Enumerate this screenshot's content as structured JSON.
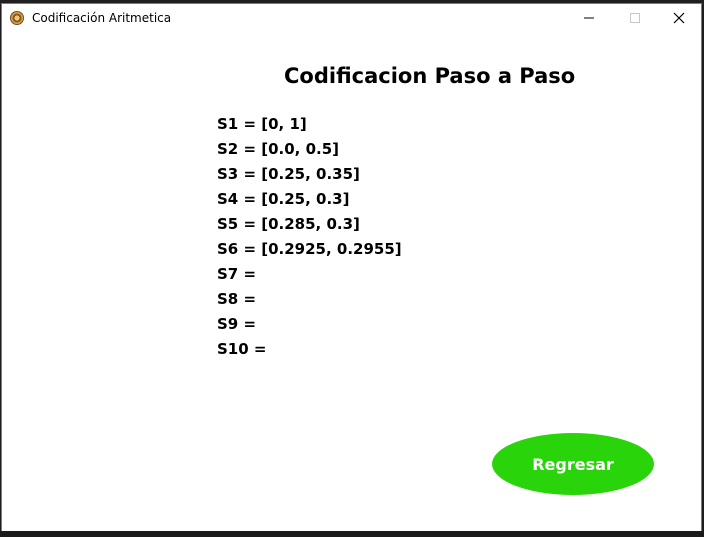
{
  "window": {
    "title": "Codificación Aritmetica",
    "icon": "app-icon"
  },
  "content": {
    "heading": "Codificacion Paso a Paso",
    "steps": [
      "S1 = [0, 1]",
      "S2 = [0.0, 0.5]",
      "S3 = [0.25, 0.35]",
      "S4 = [0.25, 0.3]",
      "S5 = [0.285, 0.3]",
      "S6 = [0.2925, 0.2955]",
      "S7 =",
      "S8 =",
      "S9 =",
      "S10 ="
    ]
  },
  "buttons": {
    "back_label": "Regresar"
  },
  "colors": {
    "back_button": "#2ad40b",
    "window_bg": "#ffffff"
  }
}
